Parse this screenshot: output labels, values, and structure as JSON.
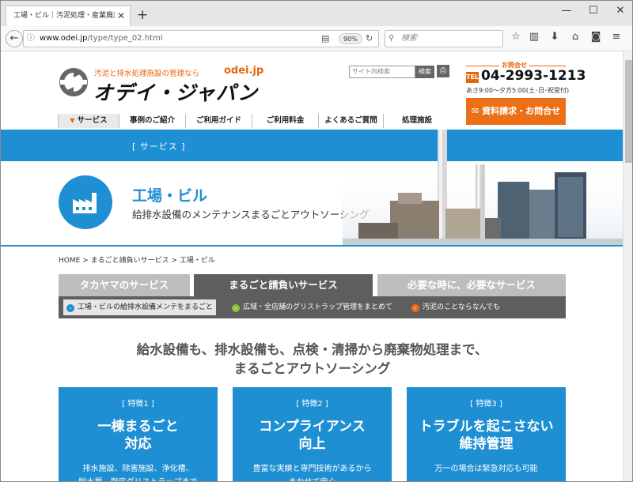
{
  "browser": {
    "tab_title": "工場・ビル｜汚泥処理・産業廃棄物",
    "new_tab": "+",
    "window_controls": {
      "minimize": "—",
      "maximize": "☐",
      "close": "✕"
    },
    "url_domain": "www.odei.jp",
    "url_path": "/type/type_02.html",
    "zoom": "90%",
    "search_placeholder": "検索",
    "icons": [
      "back-arrow-icon",
      "info-icon",
      "reader-view-icon",
      "reload-icon",
      "search-icon",
      "bookmark-star-icon",
      "library-icon",
      "download-icon",
      "home-icon",
      "pocket-icon",
      "menu-icon"
    ]
  },
  "header": {
    "tagline": "汚泥と排水処理施設の管理なら",
    "site_url": "odei.jp",
    "logo_text": "オデイ・ジャパン",
    "site_search_placeholder": "サイト内検索",
    "site_search_button": "検索",
    "contact_label": "お問合せ",
    "tel_badge": "TEL",
    "tel": "04-2993-1213",
    "hours": "あさ9:00〜夕方5:00(土･日･祝受付)",
    "cta": "資料請求・お問合せ"
  },
  "global_nav": [
    {
      "label": "サービス"
    },
    {
      "label": "事例のご紹介"
    },
    {
      "label": "ご利用ガイド"
    },
    {
      "label": "ご利用料金"
    },
    {
      "label": "よくあるご質問"
    },
    {
      "label": "処理施設"
    }
  ],
  "page": {
    "section_label": "[ サービス ]",
    "title": "工場・ビル",
    "subtitle": "給排水設備のメンテナンスまるごとアウトソーシング",
    "breadcrumb": "HOME > まるごと請負いサービス > 工場・ビル",
    "tabs": [
      {
        "label": "タカヤマのサービス",
        "color": "#bdbdbd"
      },
      {
        "label": "まるごと請負いサービス",
        "color": "#5e5e5e"
      },
      {
        "label": "必要な時に、必要なサービス",
        "color": "#bdbdbd"
      }
    ],
    "subnav": [
      {
        "label": "工場・ビルの給排水設備メンテをまるごと",
        "dot_color": "#1e8fd2"
      },
      {
        "label": "広域・全店舗のグリストラップ管理をまとめて",
        "dot_color": "#8cc63f"
      },
      {
        "label": "汚泥のことならなんでも",
        "dot_color": "#ec6f16"
      }
    ],
    "headline_1": "給水設備も、排水設備も、点検・清掃から廃棄物処理まで、",
    "headline_2": "まるごとアウトソーシング",
    "features": [
      {
        "label": "[ 特徴1 ]",
        "title_1": "一棟まるごと",
        "title_2": "対応",
        "desc_1": "排水施設、除害施設、浄化槽、",
        "desc_2": "貯水層、厨房グリストラップまで"
      },
      {
        "label": "[ 特徴2 ]",
        "title_1": "コンプライアンス",
        "title_2": "向上",
        "desc_1": "豊富な実績と専門技術があるから",
        "desc_2": "まかせて安心"
      },
      {
        "label": "[ 特徴3 ]",
        "title_1": "トラブルを起こさない",
        "title_2": "維持管理",
        "desc_1": "万一の場合は緊急対応も可能",
        "desc_2": ""
      }
    ]
  },
  "colors": {
    "accent_blue": "#1e8fd2",
    "accent_orange": "#ec6f16"
  }
}
